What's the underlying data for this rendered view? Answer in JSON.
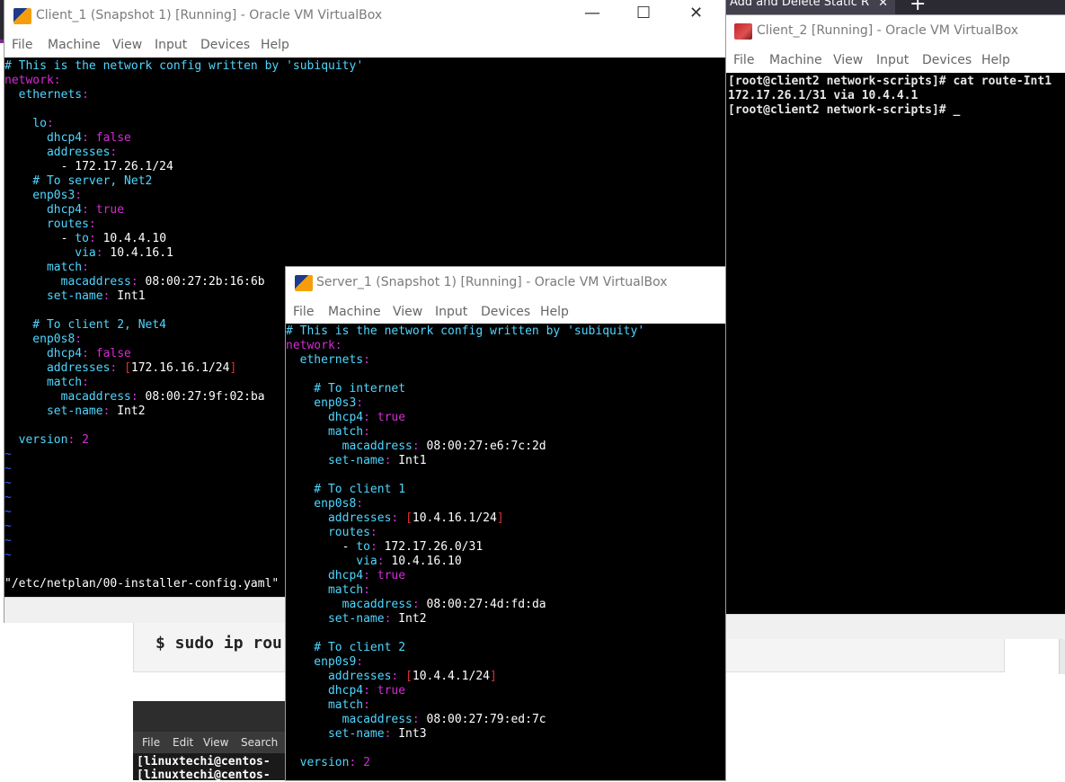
{
  "browser": {
    "tab_title": "Add and Delete Static R",
    "tab_close": "✕",
    "new_tab": "+"
  },
  "page": {
    "code_snippet": "$ sudo ip rou"
  },
  "bg_terminal": {
    "menu": [
      "File",
      "Edit",
      "View",
      "Search"
    ],
    "lines": [
      "[linuxtechi@centos-",
      "[linuxtechi@centos-"
    ]
  },
  "colors": {
    "comment": "#4fd6ff",
    "key": "#d62cd6",
    "tilde": "#3a5cff",
    "bracket": "#e03030",
    "terminal_bg": "#000000"
  },
  "menus": [
    "File",
    "Machine",
    "View",
    "Input",
    "Devices",
    "Help"
  ],
  "client1": {
    "title": "Client_1 (Snapshot 1) [Running] - Oracle VM VirtualBox",
    "controls": {
      "minimize": "—",
      "maximize": "☐",
      "close": "✕"
    },
    "status_line": "\"/etc/netplan/00-installer-config.yaml\"",
    "tilde": "~"
  },
  "client2": {
    "title": "Client_2 [Running] - Oracle VM VirtualBox",
    "lines": [
      "[root@client2 network-scripts]# cat route-Int1",
      "172.17.26.1/31 via 10.4.4.1",
      "[root@client2 network-scripts]# _"
    ]
  },
  "server1": {
    "title": "Server_1 (Snapshot 1) [Running] - Oracle VM VirtualBox"
  }
}
